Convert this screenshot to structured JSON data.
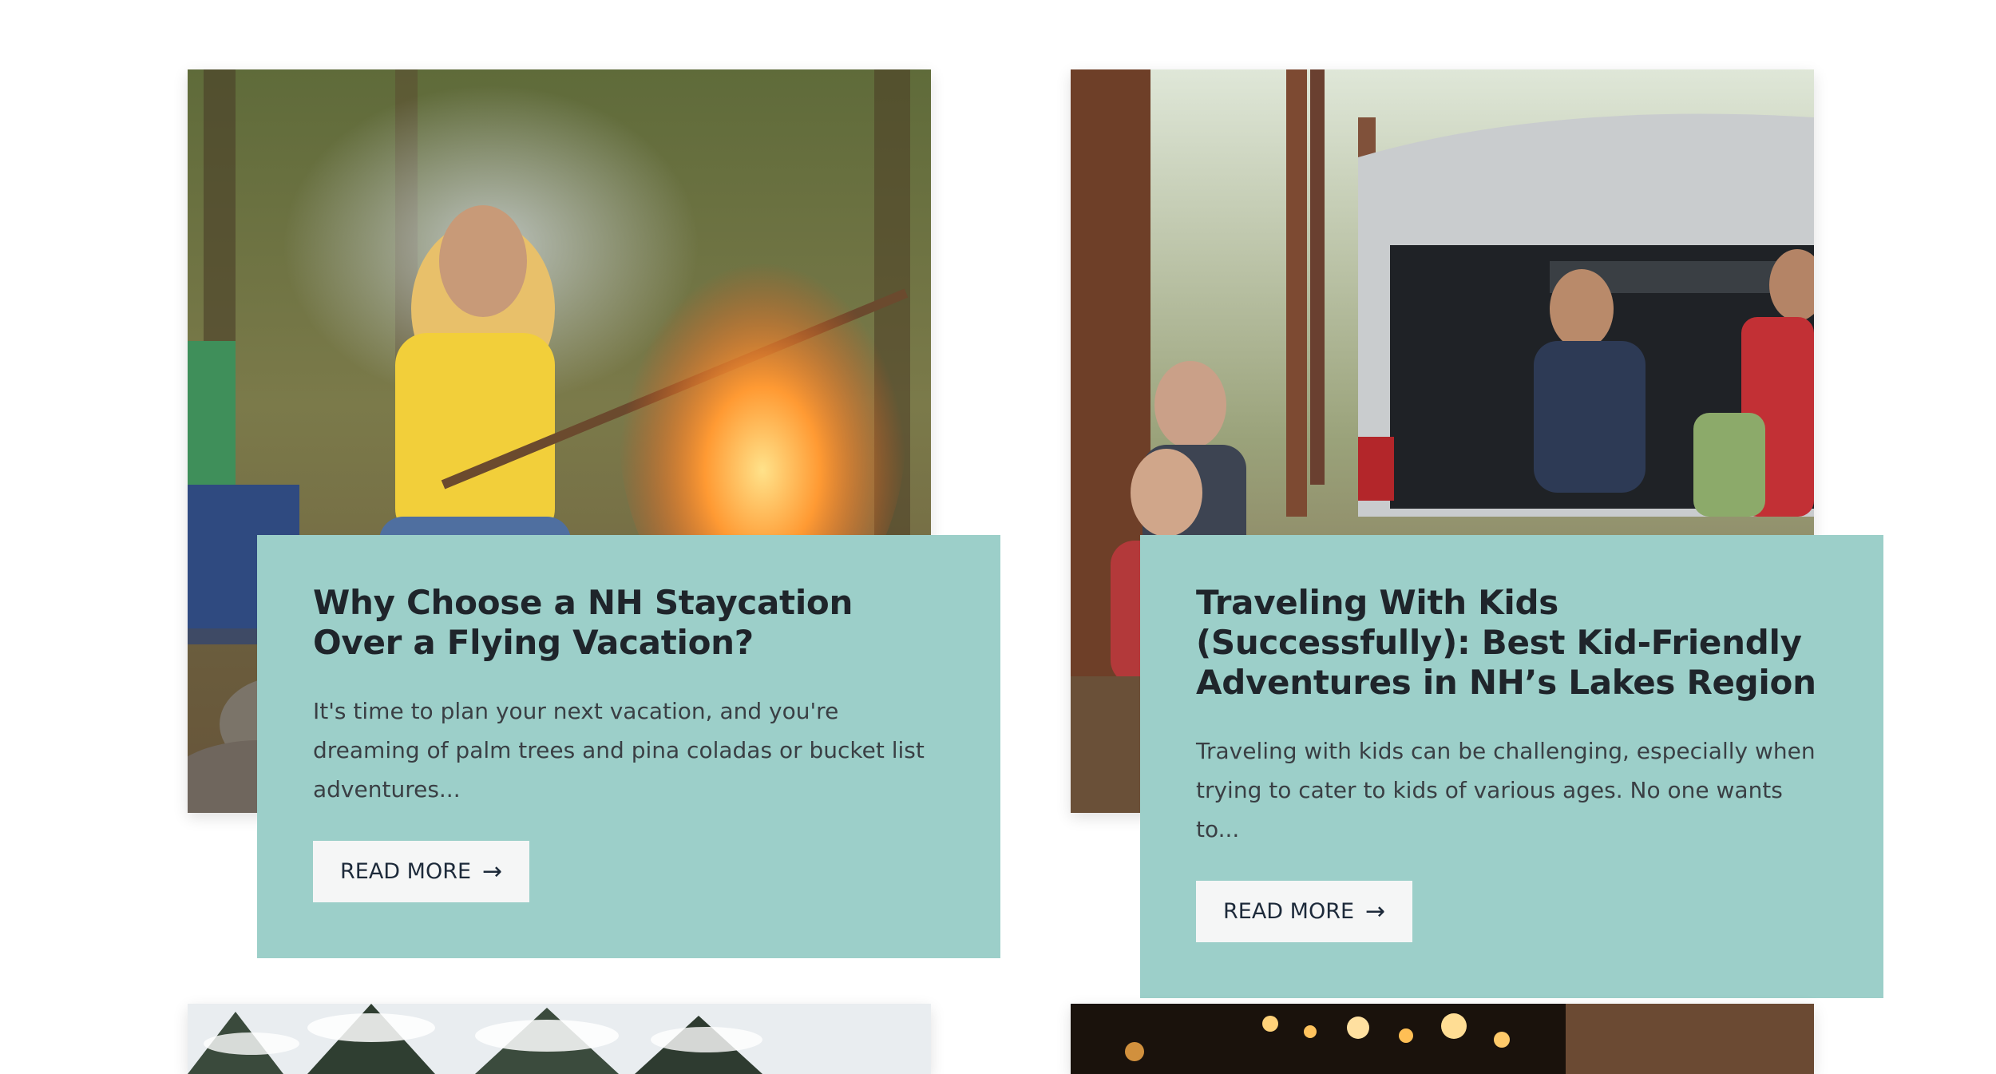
{
  "posts": [
    {
      "title": "Why Choose a NH Staycation Over a Flying Vacation?",
      "excerpt": "It's time to plan your next vacation, and you're dreaming of palm trees and pina coladas or bucket list adventures...",
      "read_more": "READ MORE",
      "image": "campfire-photo"
    },
    {
      "title": "Traveling With Kids (Successfully): Best Kid-Friendly Adventures in NH’s Lakes Region",
      "excerpt": "Traveling with kids can be challenging, especially when trying to cater to kids of various ages. No one wants to...",
      "read_more": "READ MORE",
      "image": "family-car-photo"
    }
  ],
  "bottom_images": [
    "snowy-trees-photo",
    "string-lights-photo"
  ],
  "colors": {
    "card_background": "#9ccfc9",
    "title_text": "#1f252b",
    "button_background": "#f5f6f6",
    "button_text": "#1d2a3a"
  },
  "icons": {
    "read_more_arrow": "arrow-right-icon"
  }
}
